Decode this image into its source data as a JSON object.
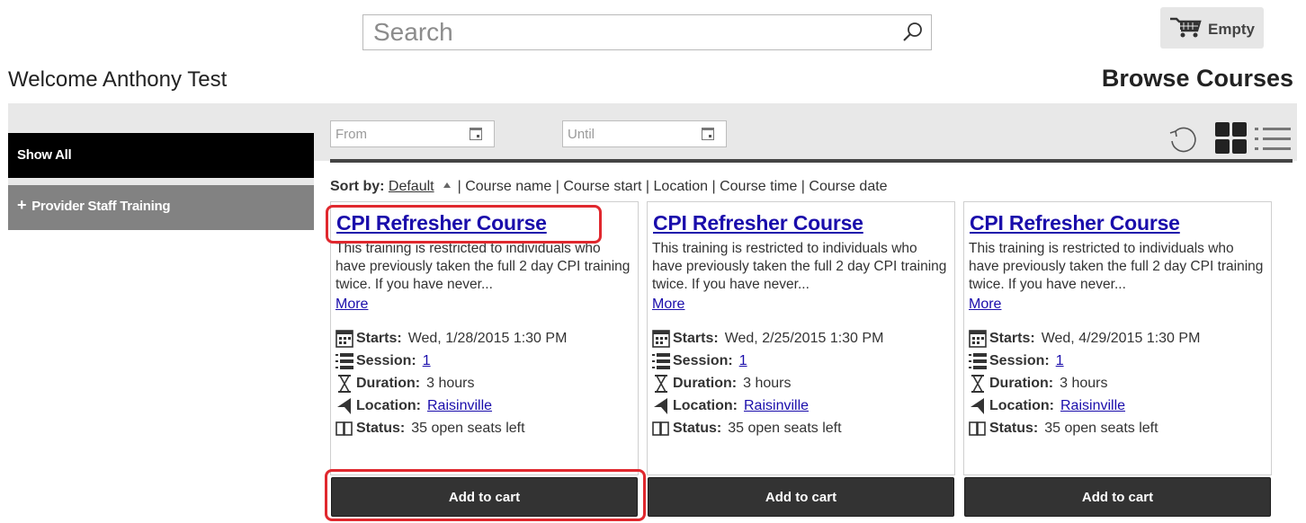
{
  "header": {
    "search_placeholder": "Search",
    "cart_label": "Empty",
    "welcome": "Welcome Anthony Test",
    "page_title": "Browse Courses"
  },
  "sidebar": {
    "items": [
      {
        "label": "Show All"
      },
      {
        "prefix": "+",
        "label": "Provider Staff Training"
      }
    ]
  },
  "filters": {
    "from_placeholder": "From",
    "until_placeholder": "Until"
  },
  "sort": {
    "label": "Sort by:",
    "options": [
      "Default",
      "Course name",
      "Course start",
      "Location",
      "Course time",
      "Course date"
    ],
    "separator": "|"
  },
  "courses": [
    {
      "title": "CPI Refresher Course",
      "description": "This training is restricted to individuals who have previously taken the full 2 day CPI training twice. If you have never...",
      "more": "More",
      "starts_label": "Starts:",
      "starts": "Wed, 1/28/2015 1:30 PM",
      "session_label": "Session:",
      "session": "1",
      "duration_label": "Duration:",
      "duration": "3 hours",
      "location_label": "Location:",
      "location": "Raisinville",
      "status_label": "Status:",
      "status": "35 open seats left",
      "button": "Add to cart"
    },
    {
      "title": "CPI Refresher Course",
      "description": "This training is restricted to individuals who have previously taken the full 2 day CPI training twice. If you have never...",
      "more": "More",
      "starts_label": "Starts:",
      "starts": "Wed, 2/25/2015 1:30 PM",
      "session_label": "Session:",
      "session": "1",
      "duration_label": "Duration:",
      "duration": "3 hours",
      "location_label": "Location:",
      "location": "Raisinville",
      "status_label": "Status:",
      "status": "35 open seats left",
      "button": "Add to cart"
    },
    {
      "title": "CPI Refresher Course",
      "description": "This training is restricted to individuals who have previously taken the full 2 day CPI training twice. If you have never...",
      "more": "More",
      "starts_label": "Starts:",
      "starts": "Wed, 4/29/2015 1:30 PM",
      "session_label": "Session:",
      "session": "1",
      "duration_label": "Duration:",
      "duration": "3 hours",
      "location_label": "Location:",
      "location": "Raisinville",
      "status_label": "Status:",
      "status": "35 open seats left",
      "button": "Add to cart"
    }
  ],
  "icons": {
    "search": "search-icon",
    "cart": "cart-icon",
    "calendar": "calendar-icon",
    "refresh": "refresh-icon",
    "grid_view": "grid-view-icon",
    "list_view": "list-view-icon",
    "session": "numbered-list-icon",
    "duration": "hourglass-icon",
    "location": "location-arrow-icon",
    "status": "book-icon"
  },
  "colors": {
    "link": "#1a0dab",
    "button": "#333333",
    "highlight": "#e0282e",
    "sidebar_active": "#000000",
    "sidebar_item": "#828282"
  }
}
